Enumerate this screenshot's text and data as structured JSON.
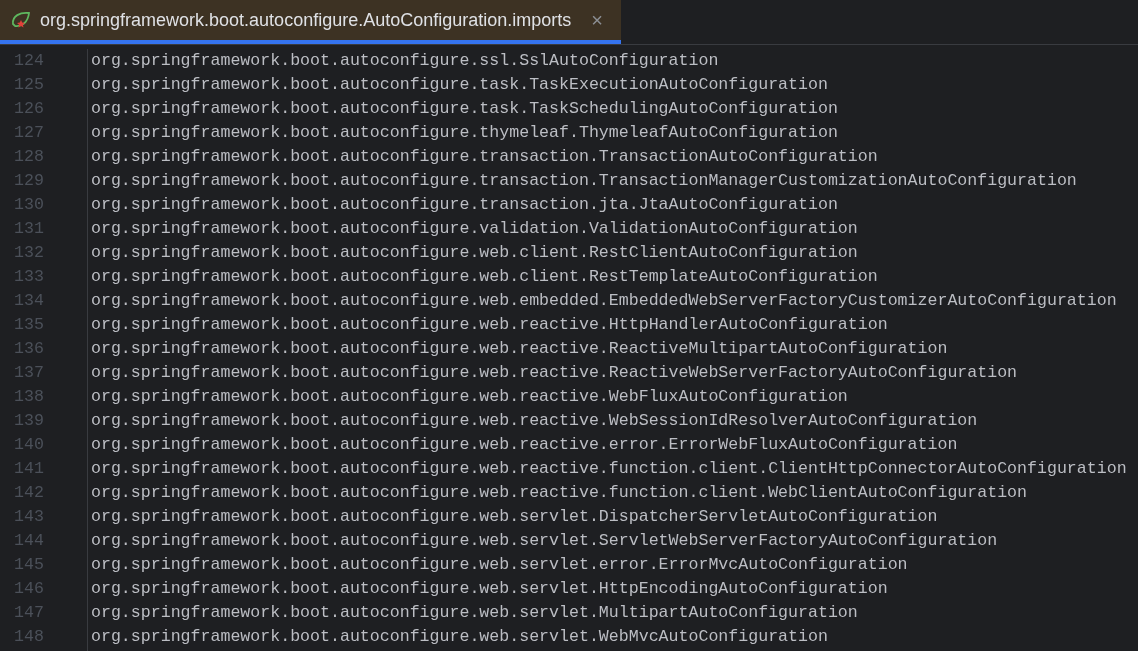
{
  "tabs": [
    {
      "label": "org.springframework.boot.autoconfigure.AutoConfiguration.imports",
      "selected": true,
      "close": "×"
    }
  ],
  "editor": {
    "lines": [
      {
        "number": "124",
        "text": "org.springframework.boot.autoconfigure.ssl.SslAutoConfiguration"
      },
      {
        "number": "125",
        "text": "org.springframework.boot.autoconfigure.task.TaskExecutionAutoConfiguration"
      },
      {
        "number": "126",
        "text": "org.springframework.boot.autoconfigure.task.TaskSchedulingAutoConfiguration"
      },
      {
        "number": "127",
        "text": "org.springframework.boot.autoconfigure.thymeleaf.ThymeleafAutoConfiguration"
      },
      {
        "number": "128",
        "text": "org.springframework.boot.autoconfigure.transaction.TransactionAutoConfiguration"
      },
      {
        "number": "129",
        "text": "org.springframework.boot.autoconfigure.transaction.TransactionManagerCustomizationAutoConfiguration"
      },
      {
        "number": "130",
        "text": "org.springframework.boot.autoconfigure.transaction.jta.JtaAutoConfiguration"
      },
      {
        "number": "131",
        "text": "org.springframework.boot.autoconfigure.validation.ValidationAutoConfiguration"
      },
      {
        "number": "132",
        "text": "org.springframework.boot.autoconfigure.web.client.RestClientAutoConfiguration"
      },
      {
        "number": "133",
        "text": "org.springframework.boot.autoconfigure.web.client.RestTemplateAutoConfiguration"
      },
      {
        "number": "134",
        "text": "org.springframework.boot.autoconfigure.web.embedded.EmbeddedWebServerFactoryCustomizerAutoConfiguration"
      },
      {
        "number": "135",
        "text": "org.springframework.boot.autoconfigure.web.reactive.HttpHandlerAutoConfiguration"
      },
      {
        "number": "136",
        "text": "org.springframework.boot.autoconfigure.web.reactive.ReactiveMultipartAutoConfiguration"
      },
      {
        "number": "137",
        "text": "org.springframework.boot.autoconfigure.web.reactive.ReactiveWebServerFactoryAutoConfiguration"
      },
      {
        "number": "138",
        "text": "org.springframework.boot.autoconfigure.web.reactive.WebFluxAutoConfiguration"
      },
      {
        "number": "139",
        "text": "org.springframework.boot.autoconfigure.web.reactive.WebSessionIdResolverAutoConfiguration"
      },
      {
        "number": "140",
        "text": "org.springframework.boot.autoconfigure.web.reactive.error.ErrorWebFluxAutoConfiguration"
      },
      {
        "number": "141",
        "text": "org.springframework.boot.autoconfigure.web.reactive.function.client.ClientHttpConnectorAutoConfiguration"
      },
      {
        "number": "142",
        "text": "org.springframework.boot.autoconfigure.web.reactive.function.client.WebClientAutoConfiguration"
      },
      {
        "number": "143",
        "text": "org.springframework.boot.autoconfigure.web.servlet.DispatcherServletAutoConfiguration"
      },
      {
        "number": "144",
        "text": "org.springframework.boot.autoconfigure.web.servlet.ServletWebServerFactoryAutoConfiguration"
      },
      {
        "number": "145",
        "text": "org.springframework.boot.autoconfigure.web.servlet.error.ErrorMvcAutoConfiguration"
      },
      {
        "number": "146",
        "text": "org.springframework.boot.autoconfigure.web.servlet.HttpEncodingAutoConfiguration"
      },
      {
        "number": "147",
        "text": "org.springframework.boot.autoconfigure.web.servlet.MultipartAutoConfiguration"
      },
      {
        "number": "148",
        "text": "org.springframework.boot.autoconfigure.web.servlet.WebMvcAutoConfiguration"
      }
    ]
  }
}
